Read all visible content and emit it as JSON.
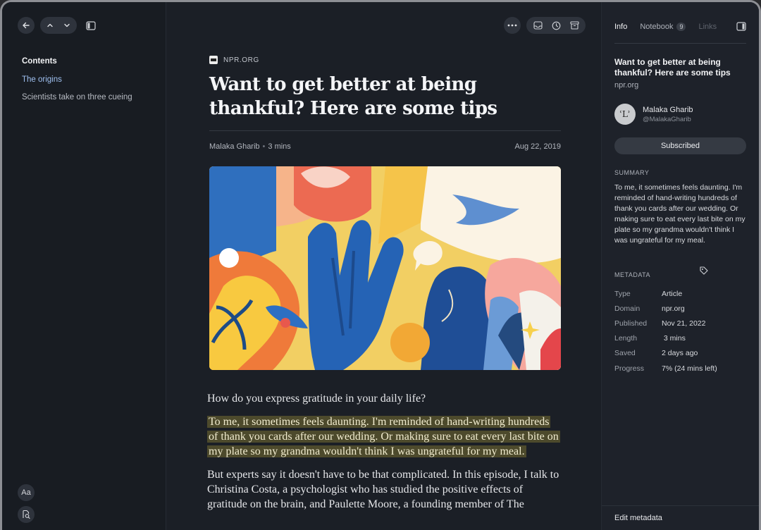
{
  "contents": {
    "title": "Contents",
    "items": [
      {
        "label": "The origins",
        "active": true
      },
      {
        "label": "Scientists take on three cueing",
        "active": false
      }
    ]
  },
  "bottom_tools": {
    "font_label": "Aa"
  },
  "article": {
    "source": "NPR.ORG",
    "title": "Want to get better at being thankful? Here are some tips",
    "author": "Malaka Gharib",
    "read_time": "3 mins",
    "date": "Aug 22, 2019",
    "paragraphs": [
      "How do you express gratitude in your daily life?",
      "To me, it sometimes feels daunting. I'm reminded of hand-writing hundreds of thank you cards after our wedding. Or making sure to eat every last bite on my plate so my grandma wouldn't think I was ungrateful for my meal.",
      "But experts say it doesn't have to be that complicated. In this episode, I talk to Christina Costa, a psychologist who has studied the positive effects of gratitude on the brain, and Paulette Moore, a founding member of The"
    ]
  },
  "panel": {
    "tabs": {
      "info": "Info",
      "notebook": "Notebook",
      "notebook_count": "9",
      "links": "Links"
    },
    "title": "Want to get better at being thankful? Here are some tips",
    "domain": "npr.org",
    "author_name": "Malaka Gharib",
    "author_handle": "@MalakaGharib",
    "subscribe_label": "Subscribed",
    "summary_label": "SUMMARY",
    "summary": "To me, it sometimes feels daunting. I'm reminded of hand-writing hundreds of thank you cards after our wedding. Or making sure to eat every last bite on my plate so my grandma wouldn't think I was ungrateful for my meal.",
    "metadata_label": "METADATA",
    "metadata": [
      {
        "key": "Type",
        "value": "Article"
      },
      {
        "key": "Domain",
        "value": "npr.org"
      },
      {
        "key": "Published",
        "value": "Nov 21, 2022"
      },
      {
        "key": "Length",
        "value": " 3 mins"
      },
      {
        "key": "Saved",
        "value": "2 days ago"
      },
      {
        "key": "Progress",
        "value": "7% (24 mins left)"
      }
    ],
    "edit_label": "Edit metadata"
  },
  "colors": {
    "accent_link": "#9fc0f0",
    "highlight": "#4d4a2c"
  }
}
